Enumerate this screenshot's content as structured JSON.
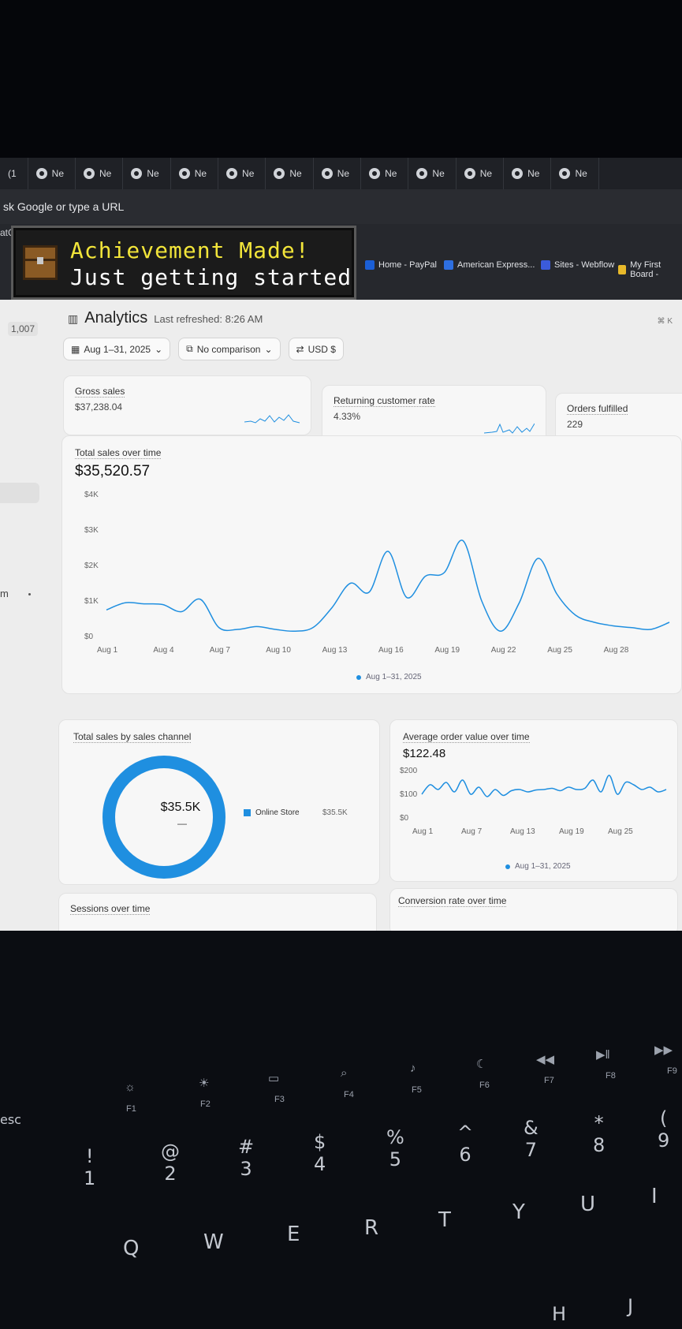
{
  "browser": {
    "tab_first": "(1",
    "tab_label": "Ne",
    "omnibox_placeholder": "sk Google or type a URL",
    "left_cut": "atG",
    "bookmarks": [
      {
        "label": "Home - PayPal",
        "color": "#1b5fd6"
      },
      {
        "label": "American Express...",
        "color": "#2e6fe0"
      },
      {
        "label": "Sites - Webflow",
        "color": "#3b5bdb"
      },
      {
        "label": "My First Board -",
        "color": "#e8b92a"
      }
    ]
  },
  "toast": {
    "title": "Achievement Made!",
    "subtitle": "Just getting started"
  },
  "sidebar": {
    "count": "1,007",
    "item_cut": "m"
  },
  "header": {
    "title": "Analytics",
    "refreshed": "Last refreshed: 8:26 AM",
    "shortcut": "⌘ K"
  },
  "filters": {
    "date": "Aug 1–31, 2025",
    "comparison": "No comparison",
    "currency": "USD $"
  },
  "kpis": [
    {
      "label": "Gross sales",
      "value": "$37,238.04"
    },
    {
      "label": "Returning customer rate",
      "value": "4.33%"
    },
    {
      "label": "Orders fulfilled",
      "value": "229"
    }
  ],
  "total_sales": {
    "label": "Total sales over time",
    "value": "$35,520.57",
    "legend": "Aug 1–31, 2025"
  },
  "sales_channel": {
    "label": "Total sales by sales channel",
    "center_value": "$35.5K",
    "center_sub": "—",
    "legend_label": "Online Store",
    "legend_value": "$35.5K"
  },
  "aov": {
    "label": "Average order value over time",
    "value": "$122.48",
    "legend": "Aug 1–31, 2025"
  },
  "sessions": {
    "label": "Sessions over time"
  },
  "conversion": {
    "label": "Conversion rate over time"
  },
  "chart_data": [
    {
      "type": "line",
      "title": "Total sales over time",
      "x": [
        "Aug 1",
        "Aug 2",
        "Aug 3",
        "Aug 4",
        "Aug 5",
        "Aug 6",
        "Aug 7",
        "Aug 8",
        "Aug 9",
        "Aug 10",
        "Aug 11",
        "Aug 12",
        "Aug 13",
        "Aug 14",
        "Aug 15",
        "Aug 16",
        "Aug 17",
        "Aug 18",
        "Aug 19",
        "Aug 20",
        "Aug 21",
        "Aug 22",
        "Aug 23",
        "Aug 24",
        "Aug 25",
        "Aug 26",
        "Aug 27",
        "Aug 28",
        "Aug 29",
        "Aug 30",
        "Aug 31"
      ],
      "x_ticks": [
        "Aug 1",
        "Aug 4",
        "Aug 7",
        "Aug 10",
        "Aug 13",
        "Aug 16",
        "Aug 19",
        "Aug 22",
        "Aug 25",
        "Aug 28"
      ],
      "y_ticks": [
        "$0",
        "$1K",
        "$2K",
        "$3K",
        "$4K"
      ],
      "ylim": [
        0,
        4000
      ],
      "series": [
        {
          "name": "Aug 1–31, 2025",
          "values": [
            750,
            950,
            920,
            900,
            700,
            1050,
            250,
            200,
            280,
            200,
            150,
            250,
            800,
            1500,
            1250,
            2400,
            1100,
            1700,
            1800,
            2700,
            1000,
            150,
            950,
            2200,
            1200,
            600,
            400,
            300,
            250,
            200,
            400
          ]
        }
      ]
    },
    {
      "type": "pie",
      "title": "Total sales by sales channel",
      "categories": [
        "Online Store"
      ],
      "values": [
        35.5
      ]
    },
    {
      "type": "line",
      "title": "Average order value over time",
      "x_ticks": [
        "Aug 1",
        "Aug 7",
        "Aug 13",
        "Aug 19",
        "Aug 25"
      ],
      "y_ticks": [
        "$0",
        "$100",
        "$200"
      ],
      "ylim": [
        0,
        200
      ],
      "series": [
        {
          "name": "Aug 1–31, 2025",
          "values": [
            100,
            140,
            120,
            150,
            110,
            160,
            100,
            130,
            90,
            120,
            95,
            115,
            120,
            110,
            118,
            120,
            125,
            115,
            130,
            120,
            125,
            160,
            110,
            180,
            100,
            150,
            140,
            120,
            130,
            110,
            120
          ]
        }
      ]
    }
  ]
}
